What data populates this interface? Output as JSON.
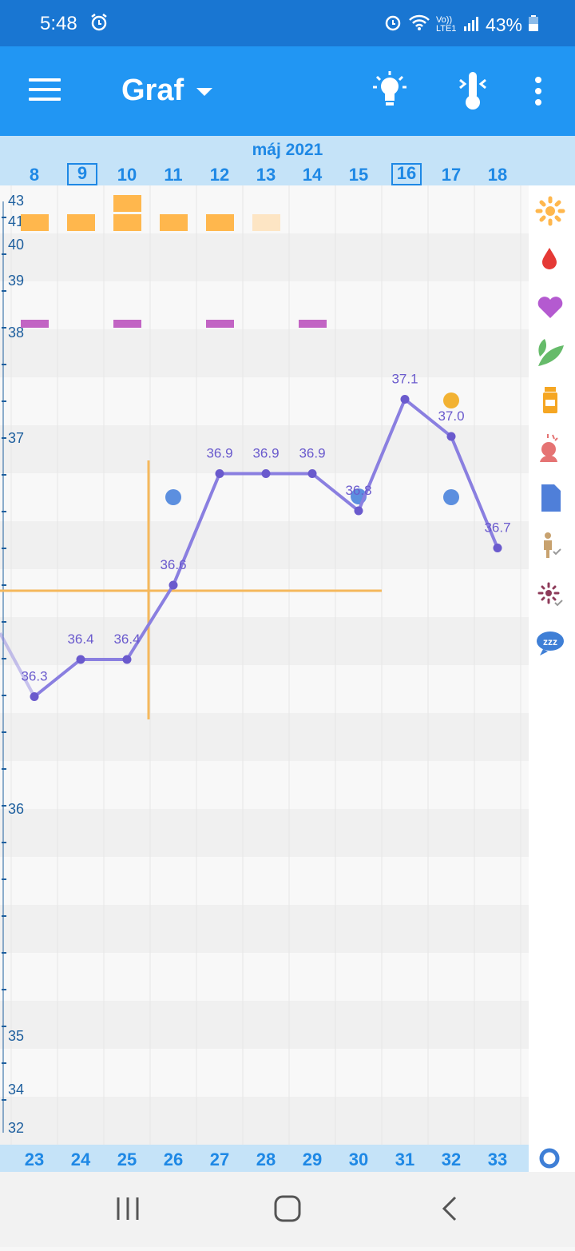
{
  "status_bar": {
    "time": "5:48",
    "battery": "43%",
    "network": "LTE1",
    "volte": "Vo))"
  },
  "app_bar": {
    "title": "Graf"
  },
  "calendar": {
    "month": "máj 2021",
    "days": [
      "8",
      "9",
      "10",
      "11",
      "12",
      "13",
      "14",
      "15",
      "16",
      "17",
      "18"
    ],
    "highlighted_days": [
      "9",
      "16"
    ],
    "cycle_days": [
      "23",
      "24",
      "25",
      "26",
      "27",
      "28",
      "29",
      "30",
      "31",
      "32",
      "33"
    ]
  },
  "y_axis": {
    "labels": [
      "43",
      "41",
      "40",
      "39",
      "38",
      "37",
      "36",
      "35",
      "34",
      "32"
    ]
  },
  "colors": {
    "accent": "#2196f3",
    "line": "#8a7fe0",
    "point": "#6a5acd",
    "period": "#ffb74d",
    "mucus": "#c264c4",
    "coverline": "#f5b85c"
  },
  "icons": [
    "sun-icon",
    "drop-icon",
    "heart-icon",
    "leaf-icon",
    "medicine-icon",
    "pain-icon",
    "note-icon",
    "pregnancy-test-icon",
    "ovulation-test-icon",
    "sleep-icon",
    "cycle-icon"
  ],
  "chart_data": {
    "type": "line",
    "title": "",
    "xlabel": "",
    "ylabel": "",
    "categories": [
      "8",
      "9",
      "10",
      "11",
      "12",
      "13",
      "14",
      "15",
      "16",
      "17",
      "18"
    ],
    "series": [
      {
        "values": [
          36.3,
          36.4,
          36.4,
          36.6,
          36.9,
          36.9,
          36.9,
          36.8,
          37.1,
          37.0,
          36.7
        ]
      }
    ],
    "point_labels": [
      "36.3",
      "36.4",
      "36.4",
      "36.6",
      "36.9",
      "36.9",
      "36.9",
      "36.8",
      "37.1",
      "37.0",
      "36.7"
    ],
    "coverline": 36.6,
    "ylim": [
      36.0,
      37.2
    ]
  }
}
